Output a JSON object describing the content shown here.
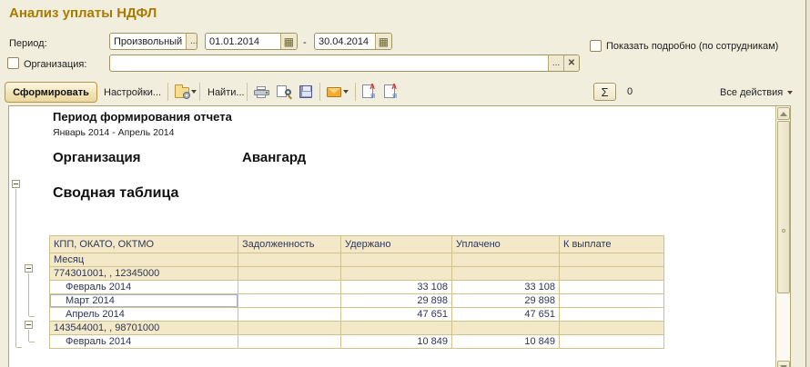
{
  "window": {
    "title": "Анализ уплаты НДФЛ"
  },
  "filters": {
    "period_label": "Период:",
    "period_type": "Произвольный",
    "browse_dots": "...",
    "date_from": "01.01.2014",
    "date_to": "30.04.2014",
    "date_separator": "-",
    "calendar_glyph": "▦",
    "show_detail_label": "Показать подробно (по сотрудникам)",
    "org_label": "Организация:",
    "org_value": "",
    "org_clear": "✕"
  },
  "toolbar": {
    "generate_label": "Сформировать",
    "settings_label": "Настройки...",
    "find_label": "Найти...",
    "sum_symbol": "Σ",
    "sum_value": "0",
    "all_actions_label": "Все действия",
    "icons": [
      "report-variants-icon",
      "print-icon",
      "preview-icon",
      "save-icon",
      "mail-icon",
      "doc-a-icon",
      "doc-a2-icon"
    ]
  },
  "report": {
    "period_header": "Период формирования отчета",
    "period_value": "Январь 2014 - Апрель 2014",
    "org_header": "Организация",
    "org_name": "Авангард",
    "summary_title": "Сводная таблица",
    "table": {
      "columns": [
        "КПП, ОКАТО, ОКТМО",
        "Задолженность",
        "Удержано",
        "Уплачено",
        "К выплате"
      ],
      "subheader": "Месяц",
      "rows": [
        {
          "type": "group",
          "cells": [
            "774301001, , 12345000",
            "",
            "",
            "",
            ""
          ]
        },
        {
          "type": "data",
          "cells": [
            "Февраль 2014",
            "",
            "33 108",
            "33 108",
            ""
          ]
        },
        {
          "type": "data",
          "selected": true,
          "cells": [
            "Март 2014",
            "",
            "29 898",
            "29 898",
            ""
          ]
        },
        {
          "type": "data",
          "cells": [
            "Апрель 2014",
            "",
            "47 651",
            "47 651",
            ""
          ]
        },
        {
          "type": "group",
          "cells": [
            "143544001, , 98701000",
            "",
            "",
            "",
            ""
          ]
        },
        {
          "type": "data",
          "cells": [
            "Февраль 2014",
            "",
            "10 849",
            "10 849",
            ""
          ]
        }
      ]
    }
  },
  "colors": {
    "accent_title": "#a87b00",
    "table_header_bg": "#f3e9c9",
    "selection_bg": "#e4e9f6"
  }
}
